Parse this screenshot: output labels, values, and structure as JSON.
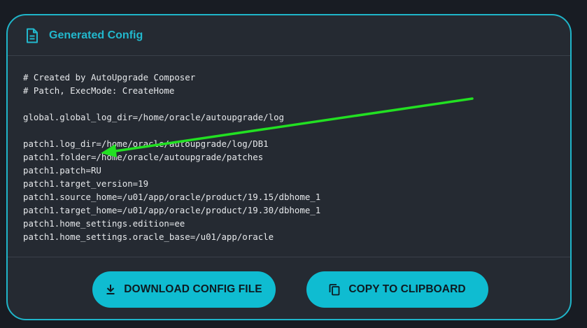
{
  "card": {
    "title": "Generated Config",
    "title_icon": "document-icon",
    "accent_color": "#1fb5c9"
  },
  "config_lines": [
    "# Created by AutoUpgrade Composer",
    "# Patch, ExecMode: CreateHome",
    "",
    "global.global_log_dir=/home/oracle/autoupgrade/log",
    "",
    "patch1.log_dir=/home/oracle/autoupgrade/log/DB1",
    "patch1.folder=/home/oracle/autoupgrade/patches",
    "patch1.patch=RU",
    "patch1.target_version=19",
    "patch1.source_home=/u01/app/oracle/product/19.15/dbhome_1",
    "patch1.target_home=/u01/app/oracle/product/19.30/dbhome_1",
    "patch1.home_settings.edition=ee",
    "patch1.home_settings.oracle_base=/u01/app/oracle"
  ],
  "actions": {
    "download_label": "DOWNLOAD CONFIG FILE",
    "download_icon": "download-icon",
    "copy_label": "COPY TO CLIPBOARD",
    "copy_icon": "copy-icon",
    "button_color": "#0fbcd1"
  },
  "annotation": {
    "arrow_color": "#22e022",
    "arrow_icon": "green-arrow"
  }
}
